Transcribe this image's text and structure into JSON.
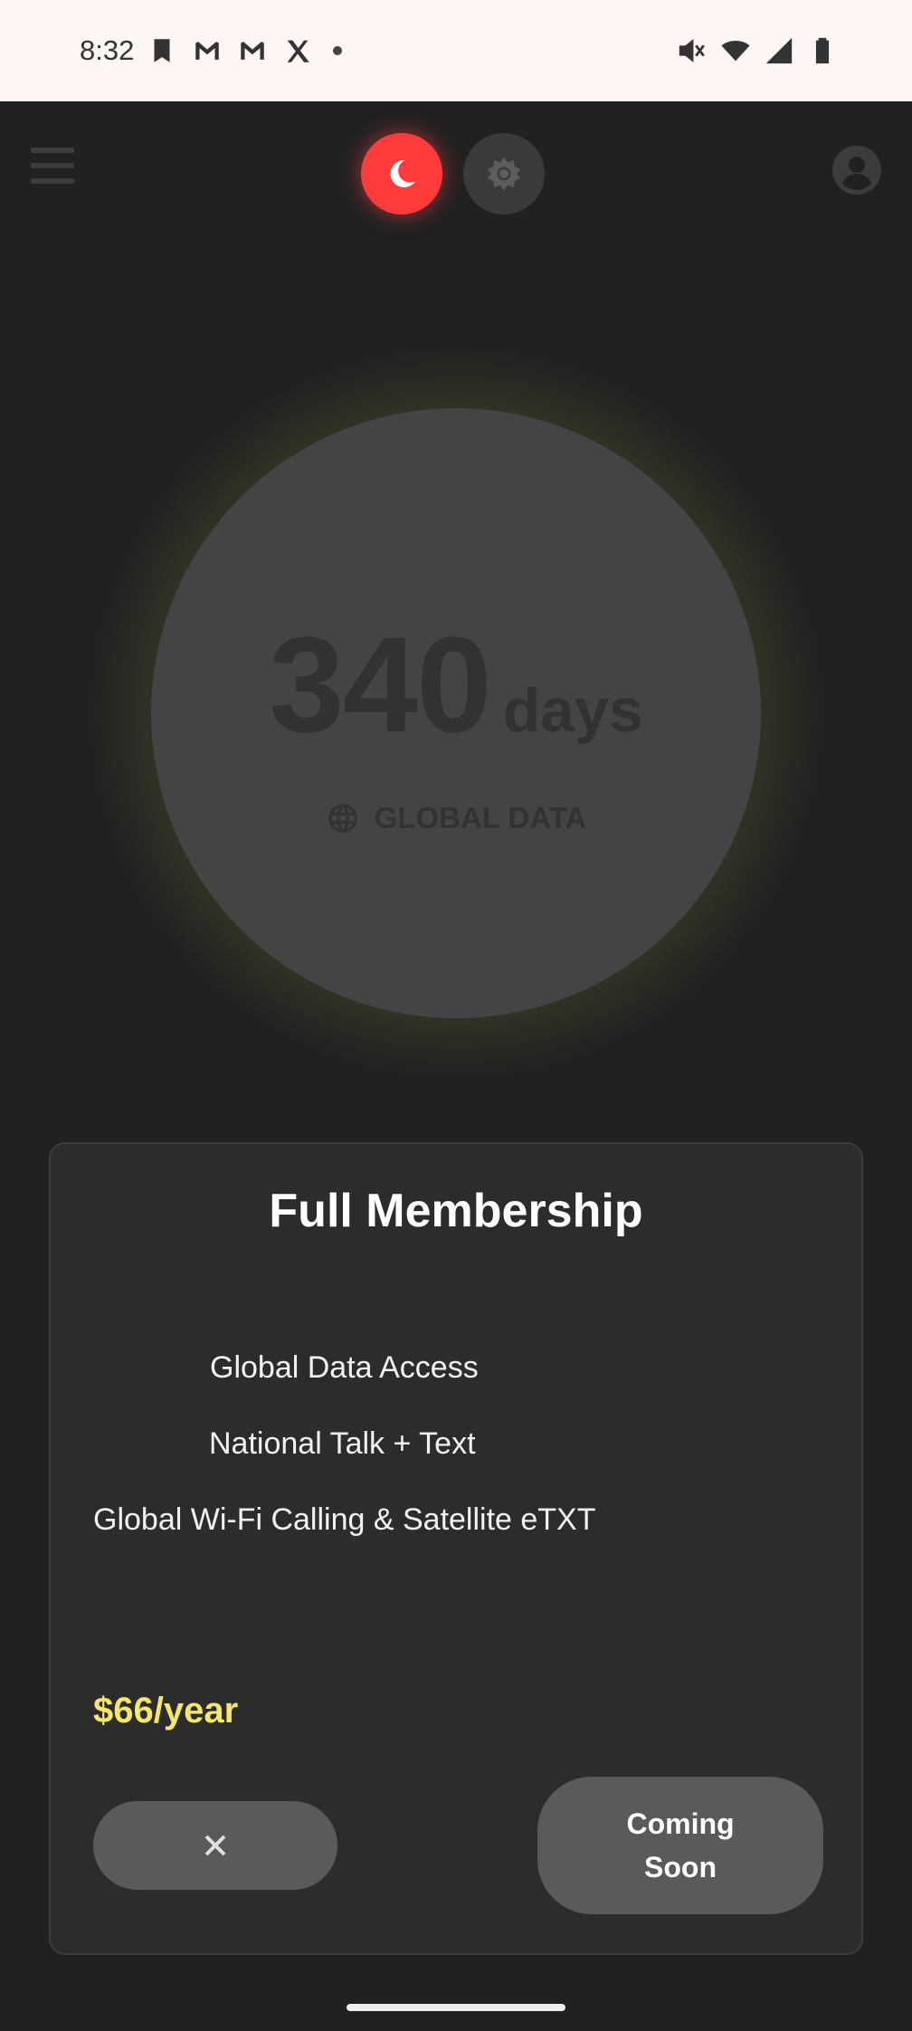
{
  "status_bar": {
    "time": "8:32",
    "left_icons": [
      "bookmark-icon",
      "gmail-icon",
      "gmail-icon",
      "x-icon",
      "dot"
    ],
    "right_icons": [
      "mute-icon",
      "wifi-icon",
      "signal-icon",
      "battery-icon"
    ]
  },
  "header": {
    "menu_icon": "hamburger-menu-icon",
    "theme_dark_icon": "moon-icon",
    "theme_light_icon": "sun-icon",
    "profile_icon": "account-icon",
    "accent_color": "#ff3b3b"
  },
  "counter": {
    "value": "340",
    "unit": "days",
    "label": "GLOBAL DATA",
    "label_icon": "globe-icon",
    "glow_color": "#d2c85a"
  },
  "card": {
    "title": "Full Membership",
    "features": [
      "Global Data Access",
      "National Talk + Text",
      "Global Wi-Fi Calling & Satellite eTXT"
    ],
    "price": "$66/year",
    "price_color": "#f5e76a",
    "close_icon": "close-icon",
    "action_label": "Coming Soon"
  }
}
